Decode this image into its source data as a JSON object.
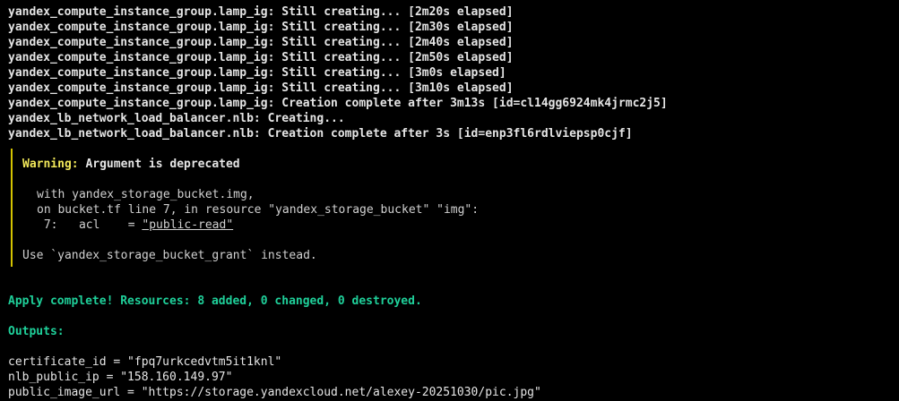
{
  "progress_lines": [
    "yandex_compute_instance_group.lamp_ig: Still creating... [2m20s elapsed]",
    "yandex_compute_instance_group.lamp_ig: Still creating... [2m30s elapsed]",
    "yandex_compute_instance_group.lamp_ig: Still creating... [2m40s elapsed]",
    "yandex_compute_instance_group.lamp_ig: Still creating... [2m50s elapsed]",
    "yandex_compute_instance_group.lamp_ig: Still creating... [3m0s elapsed]",
    "yandex_compute_instance_group.lamp_ig: Still creating... [3m10s elapsed]",
    "yandex_compute_instance_group.lamp_ig: Creation complete after 3m13s [id=cl14gg6924mk4jrmc2j5]",
    "yandex_lb_network_load_balancer.nlb: Creating...",
    "yandex_lb_network_load_balancer.nlb: Creation complete after 3s [id=enp3fl6rdlviepsp0cjf]"
  ],
  "warning": {
    "label": "Warning:",
    "title": " Argument is deprecated",
    "with_line": "with yandex_storage_bucket.img,",
    "on_line": "on bucket.tf line 7, in resource \"yandex_storage_bucket\" \"img\":",
    "code_prefix": " 7:   acl    = ",
    "code_value": "\"public-read\"",
    "advice": "Use `yandex_storage_bucket_grant` instead."
  },
  "apply_complete": "Apply complete! Resources: 8 added, 0 changed, 0 destroyed.",
  "outputs_header": "Outputs:",
  "outputs": [
    "certificate_id = \"fpq7urkcedvtm5it1knl\"",
    "nlb_public_ip = \"158.160.149.97\"",
    "public_image_url = \"https://storage.yandexcloud.net/alexey-20251030/pic.jpg\""
  ],
  "colors": {
    "background": "#000000",
    "text": "#e5e5e5",
    "warning_label": "#f2e85a",
    "warning_bar": "#d4c300",
    "success": "#1fd09a"
  }
}
